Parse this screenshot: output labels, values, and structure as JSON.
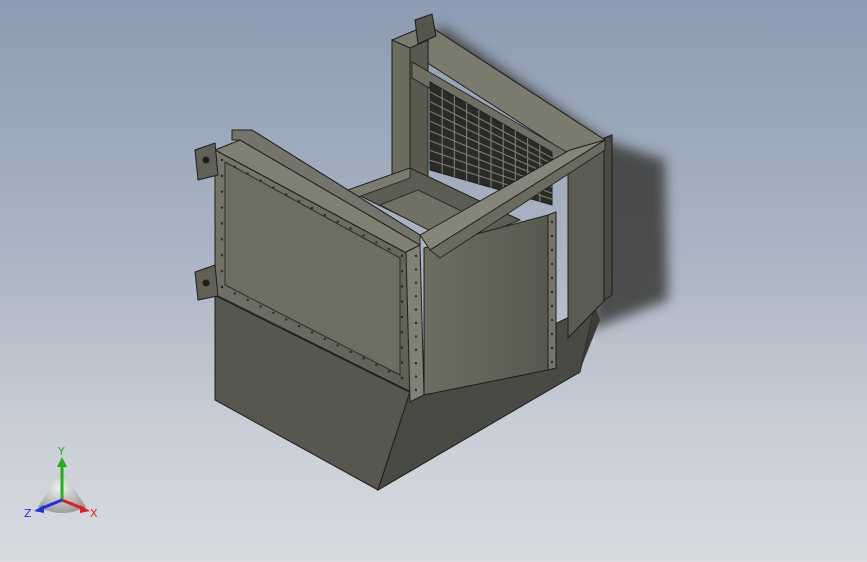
{
  "viewport": {
    "background_top": "#8d9cb3",
    "background_bottom": "#d9dbe0",
    "model": {
      "body_color": "#5f5f55",
      "panel_color": "#6a6a5f",
      "edge_color": "#1e1e1a",
      "grille_color": "#2a2a26"
    }
  },
  "triad": {
    "x_label": "X",
    "y_label": "Y",
    "z_label": "Z",
    "x_color": "#e02020",
    "y_color": "#20b020",
    "z_color": "#2030e0"
  }
}
